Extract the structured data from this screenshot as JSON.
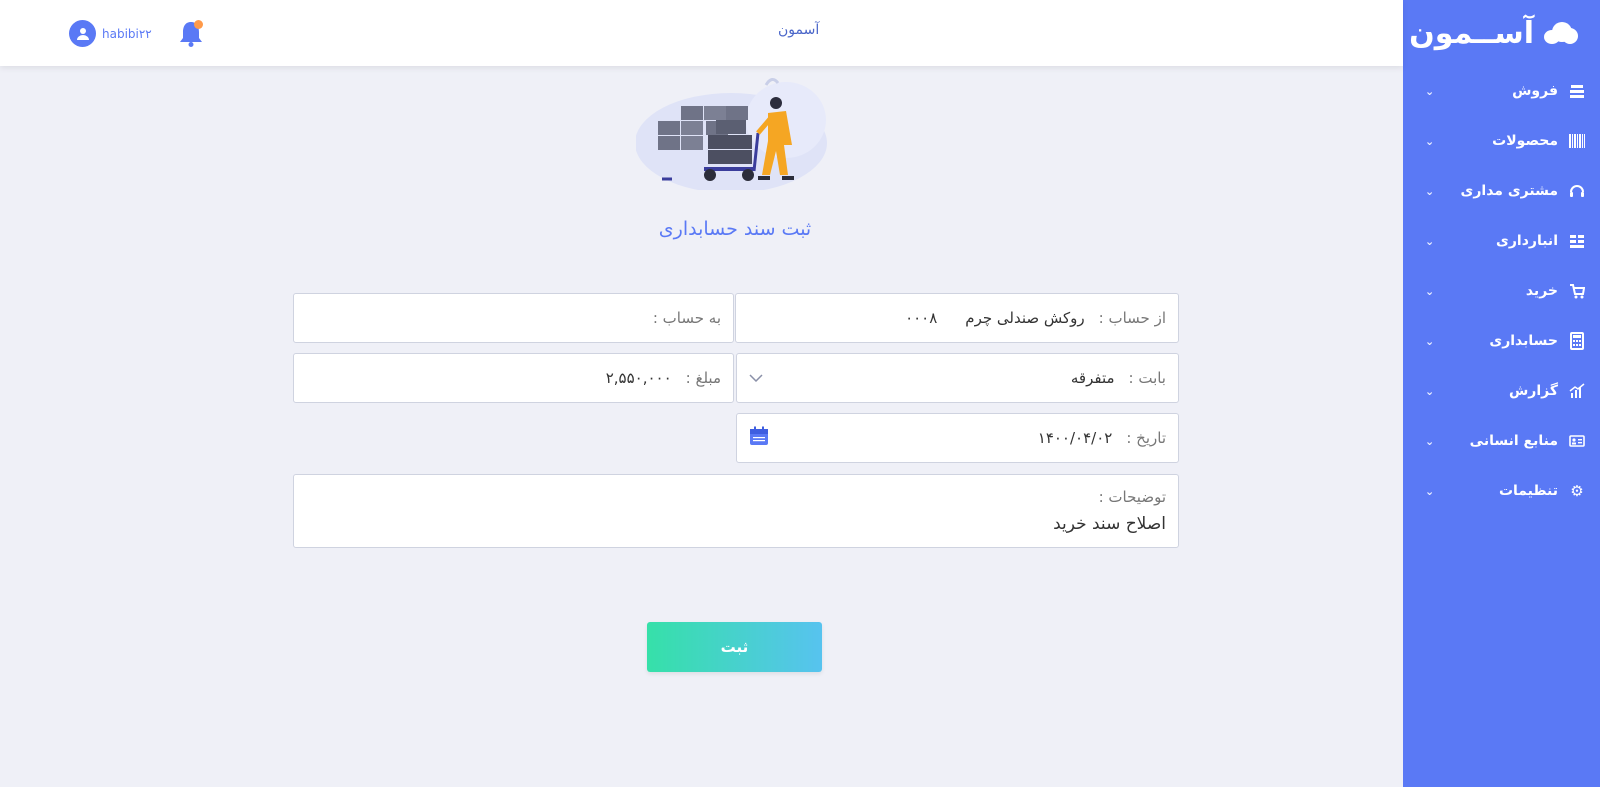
{
  "app": {
    "title": "آسمون",
    "logo_text": "آســمون"
  },
  "user": {
    "name": "habibi۲۲"
  },
  "sidebar": {
    "items": [
      {
        "label": "فروش",
        "icon": "register-icon"
      },
      {
        "label": "محصولات",
        "icon": "barcode-icon"
      },
      {
        "label": "مشتری مداری",
        "icon": "headset-icon"
      },
      {
        "label": "انبارداری",
        "icon": "warehouse-icon"
      },
      {
        "label": "خرید",
        "icon": "cart-icon"
      },
      {
        "label": "حسابداری",
        "icon": "calculator-icon"
      },
      {
        "label": "گزارش",
        "icon": "chart-icon"
      },
      {
        "label": "منابع انسانی",
        "icon": "id-card-icon"
      },
      {
        "label": "تنظیمات",
        "icon": "gear-icon"
      }
    ]
  },
  "form": {
    "title": "ثبت سند حسابداری",
    "from_account": {
      "label": "از حساب :",
      "value": "روکش صندلی چرم",
      "code": "۰۰۰۸"
    },
    "to_account": {
      "label": "به حساب :",
      "value": ""
    },
    "category": {
      "label": "بابت :",
      "value": "متفرقه"
    },
    "amount": {
      "label": "مبلغ :",
      "value": "۲,۵۵۰,۰۰۰"
    },
    "date": {
      "label": "تاریخ :",
      "value": "۱۴۰۰/۰۴/۰۲"
    },
    "description": {
      "label": "توضیحات :",
      "value": "اصلاح سند خرید"
    },
    "submit_label": "ثبت"
  },
  "colors": {
    "primary": "#5a79f5",
    "accent": "#ff9a4a",
    "button_start": "#36e0a9",
    "button_end": "#57c3ef"
  }
}
